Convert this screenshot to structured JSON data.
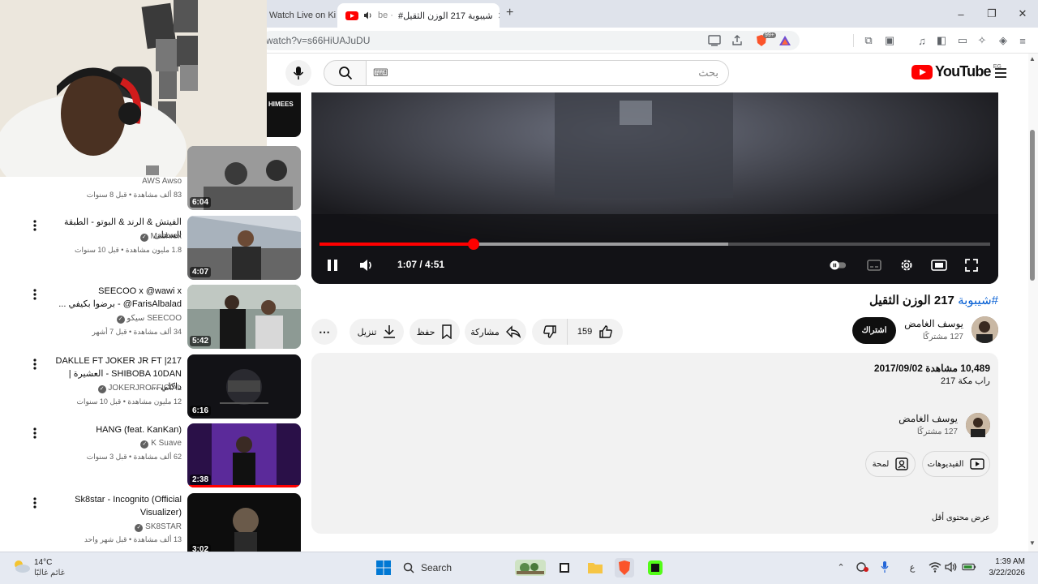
{
  "browser": {
    "tabs": [
      {
        "label": "Watch Live on Kick",
        "active": false
      },
      {
        "label": "#شيبوبة 217 الوزن الثقيل",
        "prefix": "be ·",
        "active": true
      }
    ],
    "new_tab": "+",
    "url": "watch?v=s66HiUAJuDU",
    "window": {
      "minimize": "–",
      "maximize": "❐",
      "close": "✕"
    },
    "brave_badge": "99+"
  },
  "youtube": {
    "logo_text": "YouTube",
    "country_code": "EG",
    "search_placeholder": "بحث"
  },
  "player": {
    "time_display": "1:07 / 4:51",
    "progress_played": 0.23,
    "progress_buffered": 0.61
  },
  "video": {
    "hashtag": "#شيبوبة",
    "title_rest": "217 الوزن الثقيل",
    "channel_name": "يوسف الغامض",
    "channel_subs": "127 مشتركًا",
    "subscribe_label": "اشتراك",
    "likes": "159",
    "share_label": "مشاركة",
    "save_label": "حفظ",
    "download_label": "تنزيل",
    "more_label": "⋯"
  },
  "description": {
    "views": "10,489 مشاهدة",
    "date": "2017/09/02",
    "tags": "راب مكة 217",
    "channel_name": "يوسف الغامض",
    "channel_subs": "127 مشتركًا",
    "videos_label": "الفيديوهات",
    "about_label": "لمحة",
    "show_less": "عرض محتوى أقل"
  },
  "recommendations": [
    {
      "title": "",
      "channel": "AWS Awso",
      "meta": "83 ألف مشاهدة • قبل 8 سنوات",
      "duration": "6:04",
      "thumb_color": "#8a8a8a",
      "verified": false
    },
    {
      "title": "الفيتش & الرند & البوتو - الطبقة السفلى",
      "channel": "Mashrex",
      "meta": "1.8 مليون مشاهدة • قبل 10 سنوات",
      "duration": "4:07",
      "thumb_color": "#7e8b9a",
      "verified": true
    },
    {
      "title": "SEECOO x @wawi x @FarisAlbalad - برضوا بكيفي ...",
      "channel": "SEECOO سيكو",
      "meta": "34 ألف مشاهدة • قبل 7 أشهر",
      "duration": "5:42",
      "thumb_color": "#6d7a74",
      "verified": true
    },
    {
      "title": "217| DAKLLE FT JOKER JR FT SHIBOBA 10DAN - العشيرة | داكلي ...",
      "channel": "JOKERJROFFICIAL",
      "meta": "12 مليون مشاهدة • قبل 10 سنوات",
      "duration": "6:16",
      "thumb_color": "#1a1a1e",
      "verified": true
    },
    {
      "title": "HANG (feat. KanKan)",
      "channel": "K Suave",
      "meta": "62 ألف مشاهدة • قبل 3 سنوات",
      "duration": "2:38",
      "thumb_color": "#3b1e5e",
      "verified": true
    },
    {
      "title": "Sk8star - Incognito (Official Visualizer)",
      "channel": "SK8STAR",
      "meta": "13 ألف مشاهدة • قبل شهر واحد",
      "duration": "3:02",
      "thumb_color": "#141414",
      "verified": true
    }
  ],
  "top_thumb_label": "HIMEES",
  "taskbar": {
    "temperature": "14°C",
    "weather": "غائم غالبًا",
    "search_label": "Search",
    "time": "1:39 AM",
    "date": "3/22/2026",
    "lang": "ع"
  }
}
